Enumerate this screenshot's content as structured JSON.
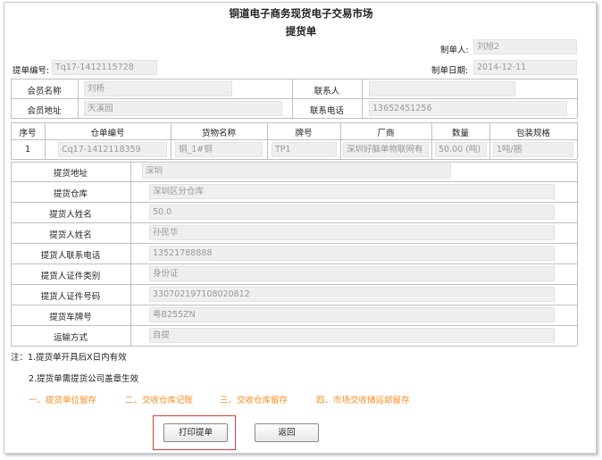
{
  "header": {
    "market_title": "铜道电子商务现货电子交易市场",
    "doc_title": "提货单"
  },
  "meta": {
    "maker_label": "制单人:",
    "maker_value": "刘旭2",
    "bill_no_label": "提单编号:",
    "bill_no_value": "Tq17-1412115728",
    "date_label": "制单日期:",
    "date_value": "2014-12-11"
  },
  "member": {
    "name_label": "会员名称",
    "name_value": "刘杨",
    "contact_label": "联系人",
    "contact_value": "",
    "address_label": "会员地址",
    "address_value": "天溪园",
    "phone_label": "联系电话",
    "phone_value": "13652451256"
  },
  "goods_table": {
    "headers": [
      "序号",
      "仓单编号",
      "货物名称",
      "牌号",
      "厂商",
      "数量",
      "包装规格"
    ],
    "rows": [
      [
        "1",
        "Cq17-1412118359",
        "铜_1#铜",
        "TP1",
        "深圳好脑单物联网有",
        "50.00 (吨)",
        "1吨/捆"
      ]
    ]
  },
  "pickup": {
    "address_label": "提货地址",
    "address_value": "深圳",
    "warehouse_label": "提货仓库",
    "warehouse_value": "深圳区分仓库",
    "person_name_label": "提货人姓名",
    "person_name_value": "50.0",
    "person_name2_label": "提货人姓名",
    "person_name2_value": "孙民华",
    "person_phone_label": "提货人联系电话",
    "person_phone_value": "13521788888",
    "id_type_label": "提货人证件类别",
    "id_type_value": "身份证",
    "id_no_label": "提货人证件号码",
    "id_no_value": "330702197108020812",
    "plate_label": "提货车牌号",
    "plate_value": "粤B255ZN",
    "transport_label": "运输方式",
    "transport_value": "自提"
  },
  "notes": {
    "note1": "注：1.提货单开具后X日内有效",
    "note2": "2.提货单需提货公司盖章生效"
  },
  "copies": {
    "c1": "一、提货单位留存",
    "c2": "二、交收仓库记账",
    "c3": "三、交收仓库留存",
    "c4": "四、市场交收储运部留存"
  },
  "buttons": {
    "print": "打印提单",
    "back": "返回"
  },
  "colors": {
    "accent_orange": "#ff8a1c",
    "highlight_red": "#e53935"
  }
}
